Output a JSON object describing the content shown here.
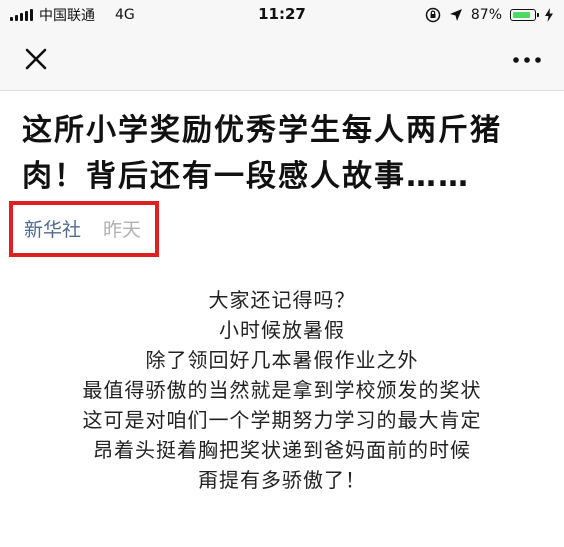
{
  "status_bar": {
    "carrier": "中国联通",
    "network": "4G",
    "time": "11:27",
    "battery": "87%",
    "battery_level": 0.87,
    "battery_color": "#4cd964",
    "icons": [
      "signal-icon",
      "rotation-lock-icon",
      "location-icon",
      "battery-icon"
    ]
  },
  "nav": {
    "close_icon": "close-icon",
    "more_icon": "more-icon"
  },
  "article": {
    "title": "这所小学奖励优秀学生每人两斤猪肉！背后还有一段感人故事……",
    "source": "新华社",
    "date": "昨天",
    "highlight_color": "#e02020",
    "lines": [
      "大家还记得吗？",
      "小时候放暑假",
      "除了领回好几本暑假作业之外",
      "最值得骄傲的当然就是拿到学校颁发的奖状",
      "这可是对咱们一个学期努力学习的最大肯定",
      "昂着头挺着胸把奖状递到爸妈面前的时候",
      "甭提有多骄傲了！"
    ]
  }
}
